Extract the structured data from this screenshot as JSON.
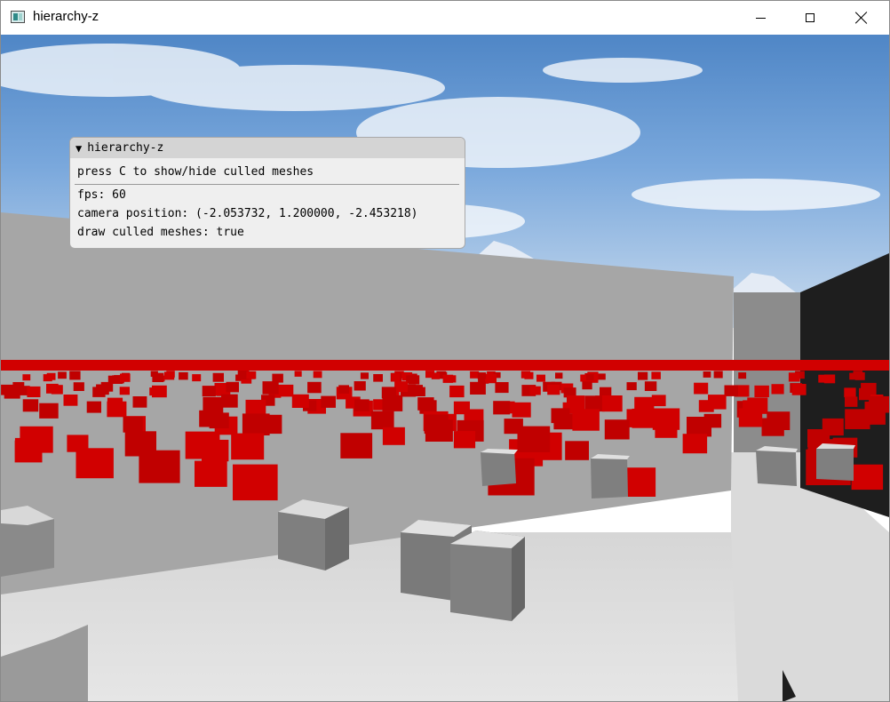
{
  "window": {
    "title": "hierarchy-z",
    "icons": {
      "app": "app-icon",
      "minimize": "minimize-icon",
      "maximize": "maximize-icon",
      "close": "close-icon"
    }
  },
  "panel": {
    "title": "hierarchy-z",
    "collapse_icon": "▼",
    "hint": "press C to show/hide culled meshes",
    "fps": "fps: 60",
    "camera_position": "camera position: (-2.053732, 1.200000, -2.453218)",
    "draw_culled": "draw culled meshes: true"
  },
  "scene": {
    "culled_mesh_color": "#d10000",
    "wall_color": "#a8a8a8",
    "floor_color": "#dcdcdc",
    "dark_wall_color": "#1e1e1e"
  }
}
